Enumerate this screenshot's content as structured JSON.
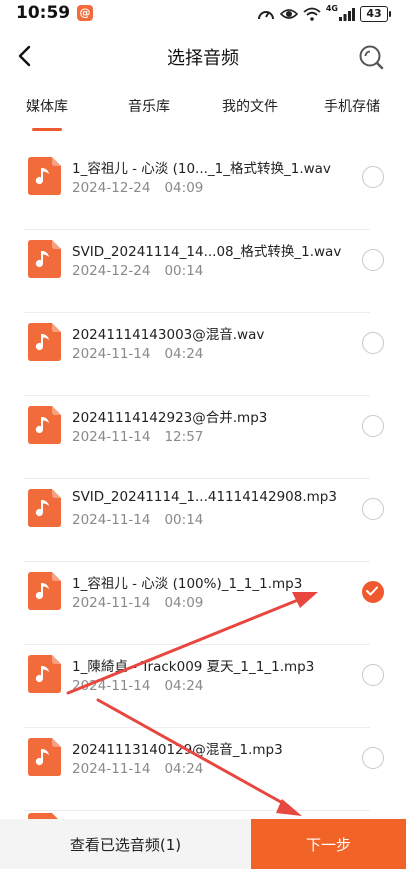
{
  "status_bar": {
    "time": "10:59",
    "notification_app_glyph": "@",
    "network_label": "4G",
    "battery": "43"
  },
  "header": {
    "title": "选择音频"
  },
  "tabs": [
    {
      "label": "媒体库",
      "active": true
    },
    {
      "label": "音乐库",
      "active": false
    },
    {
      "label": "我的文件",
      "active": false
    },
    {
      "label": "手机存储",
      "active": false
    }
  ],
  "files": [
    {
      "name": "1_容祖儿 - 心淡 (10..._1_格式转换_1.wav",
      "date": "2024-12-24",
      "time": "04:09",
      "selected": false
    },
    {
      "name": "SVID_20241114_14...08_格式转换_1.wav",
      "date": "2024-12-24",
      "time": "00:14",
      "selected": false
    },
    {
      "name": "20241114143003@混音.wav",
      "date": "2024-11-14",
      "time": "04:24",
      "selected": false
    },
    {
      "name": "20241114142923@合并.mp3",
      "date": "2024-11-14",
      "time": "12:57",
      "selected": false
    },
    {
      "name": "SVID_20241114_1...41114142908.mp3",
      "date": "2024-11-14",
      "time": "00:14",
      "selected": false
    },
    {
      "name": "1_容祖儿 - 心淡 (100%)_1_1_1.mp3",
      "date": "2024-11-14",
      "time": "04:09",
      "selected": true
    },
    {
      "name": "1_陳綺貞 - Track009 夏天_1_1_1.mp3",
      "date": "2024-11-14",
      "time": "04:24",
      "selected": false
    },
    {
      "name": "20241113140129@混音_1.mp3",
      "date": "2024-11-14",
      "time": "04:24",
      "selected": false
    }
  ],
  "bottom_bar": {
    "view_selected_label": "查看已选音频(1)",
    "next_label": "下一步"
  },
  "colors": {
    "accent": "#f16327",
    "file_icon": "#f26b3a",
    "annotation_arrow": "#e8473f"
  },
  "icons": {
    "back": "chevron-left-icon",
    "search": "search-icon",
    "file": "music-note-icon",
    "selected": "checkmark-icon"
  }
}
